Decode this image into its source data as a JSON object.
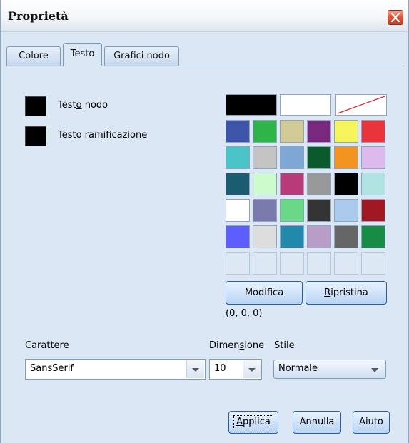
{
  "window": {
    "title": "Proprietà"
  },
  "tabs": [
    {
      "label": "Colore",
      "active": false
    },
    {
      "label": "Testo",
      "active": true
    },
    {
      "label": "Grafici nodo",
      "active": false
    }
  ],
  "color_settings": [
    {
      "label_pre": "Test",
      "label_mnemonic": "o",
      "label_post": " nodo",
      "color": "#000000"
    },
    {
      "label_pre": "Testo ramificazione",
      "label_mnemonic": "",
      "label_post": "",
      "color": "#000000"
    }
  ],
  "palette": {
    "top_row": [
      "#000000",
      "#ffffff",
      "none"
    ],
    "rows": [
      [
        "#3d54a8",
        "#2fb44a",
        "#d2cb98",
        "#7a2a7e",
        "#f7f55c",
        "#e8343a"
      ],
      [
        "#4ac3c6",
        "#c4c4c4",
        "#7ea7d6",
        "#0a5a2e",
        "#f49420",
        "#dcbaec"
      ],
      [
        "#1a5c70",
        "#ccfccc",
        "#b83a78",
        "#999999",
        "#000000",
        "#b2e3e3"
      ],
      [
        "#ffffff",
        "#7a7aac",
        "#6ad886",
        "#333333",
        "#aacbec",
        "#a01822"
      ],
      [
        "#5e5eff",
        "#dddddd",
        "#2289aa",
        "#b89dc9",
        "#666666",
        "#168c44"
      ],
      [
        "empty",
        "empty",
        "empty",
        "empty",
        "empty",
        "empty"
      ]
    ]
  },
  "buttons": {
    "modifica": "Modifica",
    "ripristina_mnemonic": "R",
    "ripristina_rest": "ipristina",
    "applica_mnemonic": "A",
    "applica_rest": "pplica",
    "annulla": "Annulla",
    "aiuto": "Aiuto"
  },
  "rgb_readout": "(0, 0, 0)",
  "font": {
    "carattere_label": "Carattere",
    "carattere_value": "SansSerif",
    "dimensione_label_pre": "Dimen",
    "dimensione_label_mnemonic": "s",
    "dimensione_label_post": "ione",
    "dimensione_value": "10",
    "stile_label": "Stile",
    "stile_value": "Normale"
  },
  "colors": {
    "dialog_bg": "#dbe7f5",
    "button_border": "#245fa7"
  }
}
